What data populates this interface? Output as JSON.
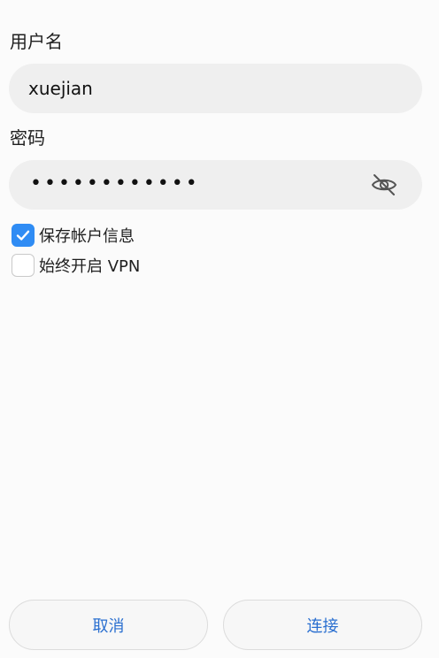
{
  "username": {
    "label": "用户名",
    "value": "xuejian"
  },
  "password": {
    "label": "密码",
    "masked_value": "••••••••••••",
    "visibility_icon": "eye-off-icon"
  },
  "options": {
    "save_account": {
      "label": "保存帐户信息",
      "checked": true
    },
    "always_vpn": {
      "label": "始终开启 VPN",
      "checked": false
    }
  },
  "buttons": {
    "cancel_label": "取消",
    "connect_label": "连接"
  },
  "colors": {
    "accent": "#2f8cf4",
    "button_text": "#2a6fd0",
    "input_bg": "#efefef",
    "page_bg": "#fbfbfb"
  }
}
